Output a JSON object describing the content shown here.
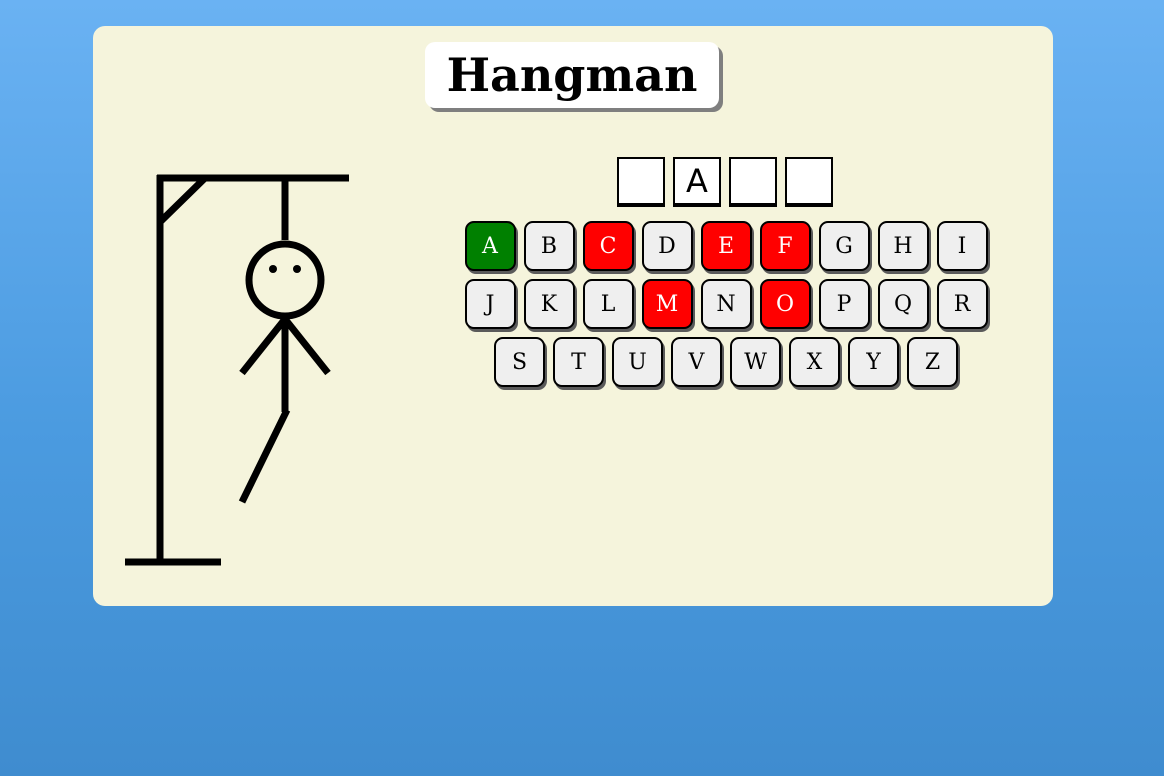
{
  "title": "Hangman",
  "colors": {
    "correct": "#008000",
    "wrong": "#ff0000",
    "unused": "#efefef",
    "panel": "#f5f4dc"
  },
  "word_slots": [
    "",
    "A",
    "",
    ""
  ],
  "keyboard": {
    "rows": [
      [
        {
          "letter": "A",
          "state": "correct"
        },
        {
          "letter": "B",
          "state": "unused"
        },
        {
          "letter": "C",
          "state": "wrong"
        },
        {
          "letter": "D",
          "state": "unused"
        },
        {
          "letter": "E",
          "state": "wrong"
        },
        {
          "letter": "F",
          "state": "wrong"
        },
        {
          "letter": "G",
          "state": "unused"
        },
        {
          "letter": "H",
          "state": "unused"
        },
        {
          "letter": "I",
          "state": "unused"
        }
      ],
      [
        {
          "letter": "J",
          "state": "unused"
        },
        {
          "letter": "K",
          "state": "unused"
        },
        {
          "letter": "L",
          "state": "unused"
        },
        {
          "letter": "M",
          "state": "wrong"
        },
        {
          "letter": "N",
          "state": "unused"
        },
        {
          "letter": "O",
          "state": "wrong"
        },
        {
          "letter": "P",
          "state": "unused"
        },
        {
          "letter": "Q",
          "state": "unused"
        },
        {
          "letter": "R",
          "state": "unused"
        }
      ],
      [
        {
          "letter": "S",
          "state": "unused"
        },
        {
          "letter": "T",
          "state": "unused"
        },
        {
          "letter": "U",
          "state": "unused"
        },
        {
          "letter": "V",
          "state": "unused"
        },
        {
          "letter": "W",
          "state": "unused"
        },
        {
          "letter": "X",
          "state": "unused"
        },
        {
          "letter": "Y",
          "state": "unused"
        },
        {
          "letter": "Z",
          "state": "unused"
        }
      ]
    ]
  },
  "hangman": {
    "wrong_guesses": 5,
    "visible_parts": [
      "gallows",
      "rope",
      "head",
      "body",
      "left-arm",
      "right-arm",
      "left-leg"
    ]
  }
}
